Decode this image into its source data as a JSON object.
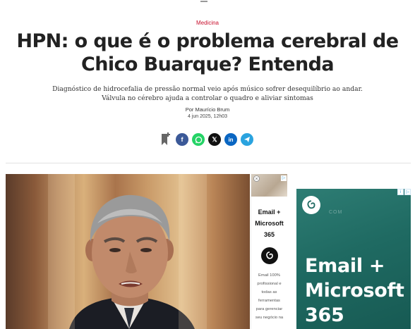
{
  "article": {
    "category": "Medicina",
    "headline": "HPN: o que é o problema cerebral de Chico Buarque? Entenda",
    "subtitle": "Diagnóstico de hidrocefalia de pressão normal veio após músico sofrer desequilíbrio ao andar. Válvula no cérebro ajuda a controlar o quadro e aliviar sintomas",
    "byline": "Por Maurício Brum",
    "date": "4 jun 2025, 12h03"
  },
  "share": {
    "icons": [
      "bookmark-icon",
      "facebook-icon",
      "whatsapp-icon",
      "x-icon",
      "linkedin-icon",
      "telegram-icon"
    ],
    "colors": {
      "facebook": "#3b5998",
      "whatsapp": "#25d366",
      "x": "#111111",
      "linkedin": "#0a66c2",
      "telegram": "#2aa3df"
    }
  },
  "ad_inline": {
    "title": "Email + Microsoft 365",
    "description": "Email 100% profissional e todas as ferramentas para gerenciar seu negócio na"
  },
  "ad_right": {
    "headline": "Email + Microsoft 365",
    "watermark": "COM"
  },
  "colors": {
    "accent": "#c8102e",
    "ad_teal": "#1f6a62"
  }
}
